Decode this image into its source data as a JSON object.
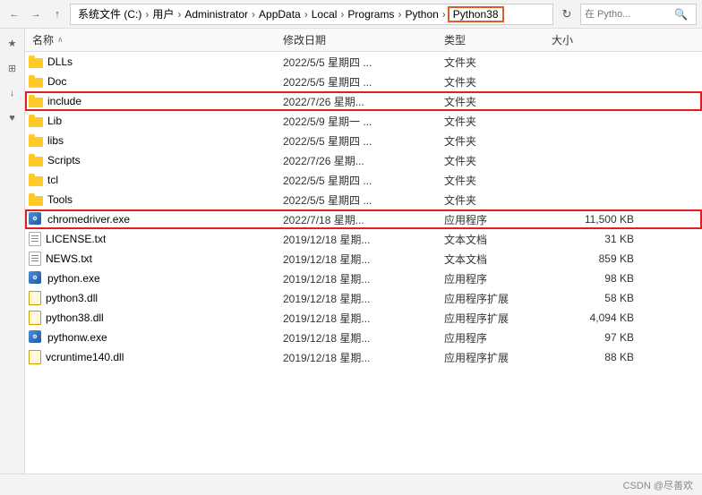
{
  "nav": {
    "back_tooltip": "后退",
    "forward_tooltip": "前进",
    "up_tooltip": "上一级",
    "breadcrumbs": [
      {
        "label": "系统文件 (C:)",
        "id": "c-drive"
      },
      {
        "label": "用户",
        "id": "users"
      },
      {
        "label": "Administrator",
        "id": "admin"
      },
      {
        "label": "AppData",
        "id": "appdata"
      },
      {
        "label": "Local",
        "id": "local"
      },
      {
        "label": "Programs",
        "id": "programs"
      },
      {
        "label": "Python",
        "id": "python"
      },
      {
        "label": "Python38",
        "id": "python38",
        "active": true
      }
    ],
    "refresh_label": "↻",
    "search_placeholder": "在 Pytho..."
  },
  "columns": {
    "name_label": "名称",
    "date_label": "修改日期",
    "type_label": "类型",
    "size_label": "大小",
    "sort_arrow": "∧"
  },
  "files": [
    {
      "name": "DLLs",
      "date": "2022/5/5 星期四 ...",
      "type": "文件夹",
      "size": "",
      "icon": "folder",
      "highlight": false
    },
    {
      "name": "Doc",
      "date": "2022/5/5 星期四 ...",
      "type": "文件夹",
      "size": "",
      "icon": "folder",
      "highlight": false
    },
    {
      "name": "include",
      "date": "2022/7/26 星期...",
      "type": "文件夹",
      "size": "",
      "icon": "folder",
      "highlight": true
    },
    {
      "name": "Lib",
      "date": "2022/5/9 星期一 ...",
      "type": "文件夹",
      "size": "",
      "icon": "folder",
      "highlight": false
    },
    {
      "name": "libs",
      "date": "2022/5/5 星期四 ...",
      "type": "文件夹",
      "size": "",
      "icon": "folder",
      "highlight": false
    },
    {
      "name": "Scripts",
      "date": "2022/7/26 星期...",
      "type": "文件夹",
      "size": "",
      "icon": "folder",
      "highlight": false
    },
    {
      "name": "tcl",
      "date": "2022/5/5 星期四 ...",
      "type": "文件夹",
      "size": "",
      "icon": "folder",
      "highlight": false
    },
    {
      "name": "Tools",
      "date": "2022/5/5 星期四 ...",
      "type": "文件夹",
      "size": "",
      "icon": "folder",
      "highlight": false
    },
    {
      "name": "chromedriver.exe",
      "date": "2022/7/18 星期...",
      "type": "应用程序",
      "size": "11,500 KB",
      "icon": "exe",
      "highlight": true
    },
    {
      "name": "LICENSE.txt",
      "date": "2019/12/18 星期...",
      "type": "文本文档",
      "size": "31 KB",
      "icon": "txt",
      "highlight": false
    },
    {
      "name": "NEWS.txt",
      "date": "2019/12/18 星期...",
      "type": "文本文档",
      "size": "859 KB",
      "icon": "txt",
      "highlight": false
    },
    {
      "name": "python.exe",
      "date": "2019/12/18 星期...",
      "type": "应用程序",
      "size": "98 KB",
      "icon": "exe",
      "highlight": false
    },
    {
      "name": "python3.dll",
      "date": "2019/12/18 星期...",
      "type": "应用程序扩展",
      "size": "58 KB",
      "icon": "dll",
      "highlight": false
    },
    {
      "name": "python38.dll",
      "date": "2019/12/18 星期...",
      "type": "应用程序扩展",
      "size": "4,094 KB",
      "icon": "dll",
      "highlight": false
    },
    {
      "name": "pythonw.exe",
      "date": "2019/12/18 星期...",
      "type": "应用程序",
      "size": "97 KB",
      "icon": "exe",
      "highlight": false
    },
    {
      "name": "vcruntime140.dll",
      "date": "2019/12/18 星期...",
      "type": "应用程序扩展",
      "size": "88 KB",
      "icon": "dll",
      "highlight": false
    }
  ],
  "status": {
    "watermark": "CSDN @尽善欢"
  },
  "sidebar_icons": [
    "★",
    "⊞",
    "↓",
    "♥"
  ]
}
